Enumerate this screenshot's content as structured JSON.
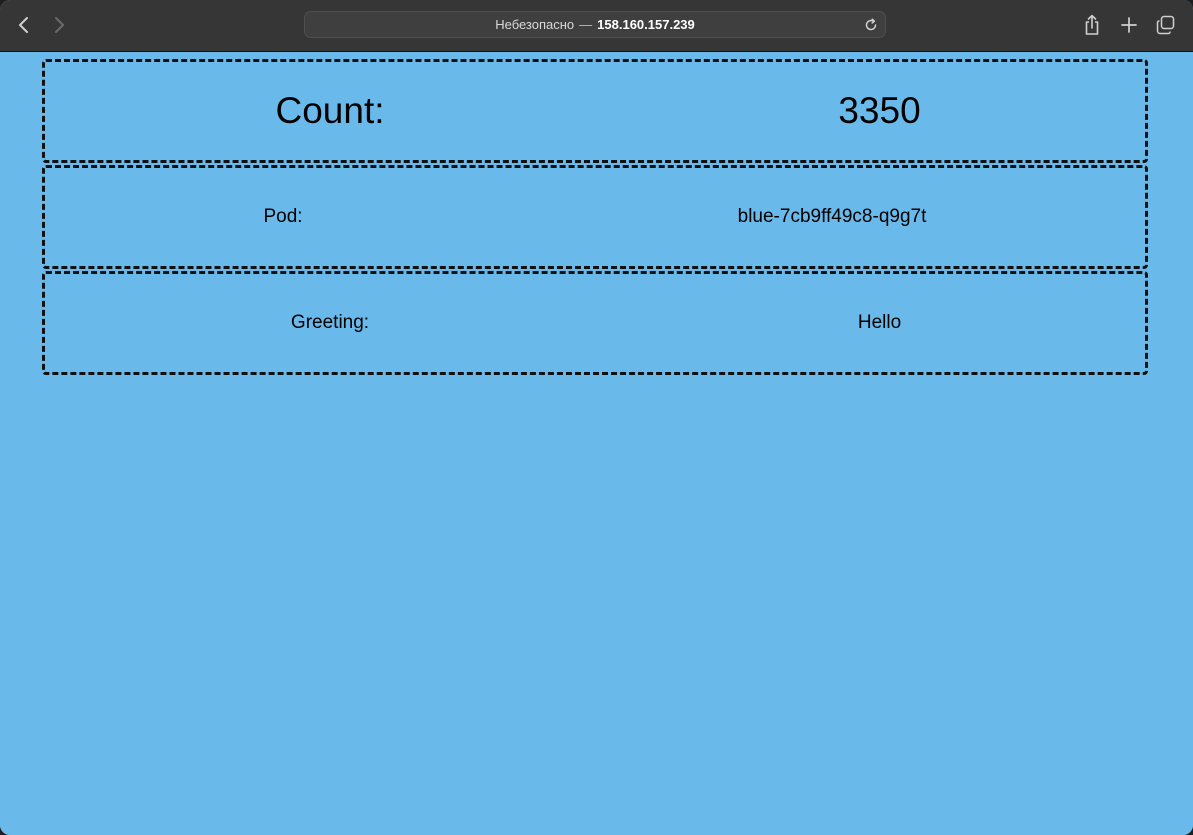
{
  "browser": {
    "address": {
      "security_label": "Небезопасно",
      "separator": "—",
      "host": "158.160.157.239"
    },
    "icons": {
      "back": "chevron-left-icon",
      "forward": "chevron-right-icon",
      "reload": "reload-icon",
      "share": "share-icon",
      "new_tab": "plus-icon",
      "tabs": "tabs-overview-icon"
    }
  },
  "page": {
    "background_color": "#69baea",
    "rows": [
      {
        "label": "Count:",
        "value": "3350"
      },
      {
        "label": "Pod:",
        "value": "blue-7cb9ff49c8-q9g7t"
      },
      {
        "label": "Greeting:",
        "value": "Hello"
      }
    ]
  }
}
